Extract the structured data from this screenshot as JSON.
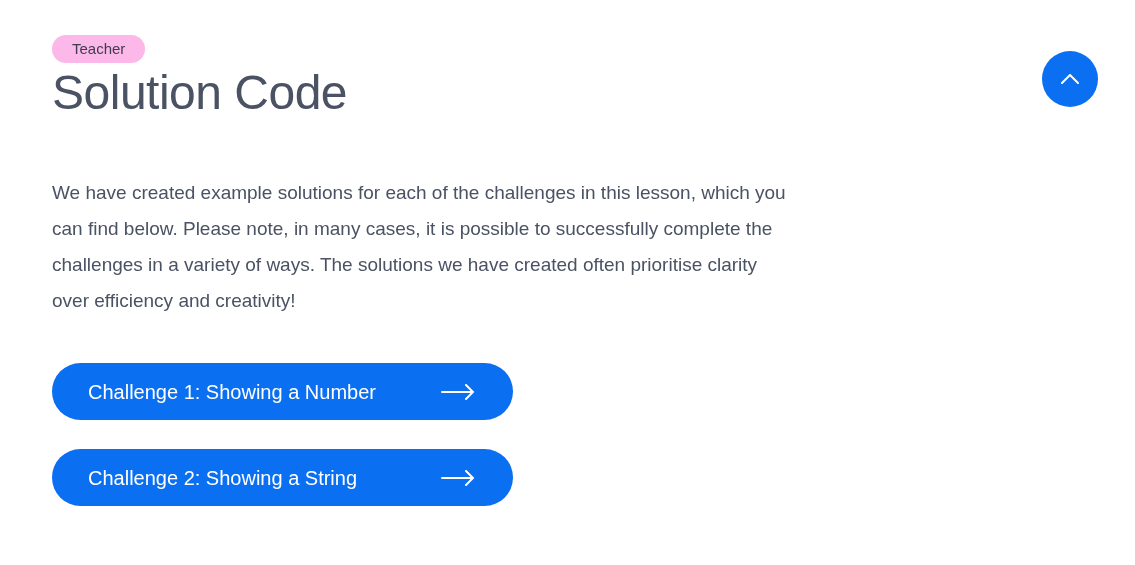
{
  "badge": "Teacher",
  "title": "Solution Code",
  "description": "We have created example solutions for each of the challenges in this lesson, which you can find below. Please note, in many cases, it is possible to successfully complete the challenges in a variety of ways. The solutions we have created often prioritise clarity over efficiency and creativity!",
  "buttons": [
    {
      "label": "Challenge 1: Showing a Number"
    },
    {
      "label": "Challenge 2: Showing a String"
    }
  ]
}
